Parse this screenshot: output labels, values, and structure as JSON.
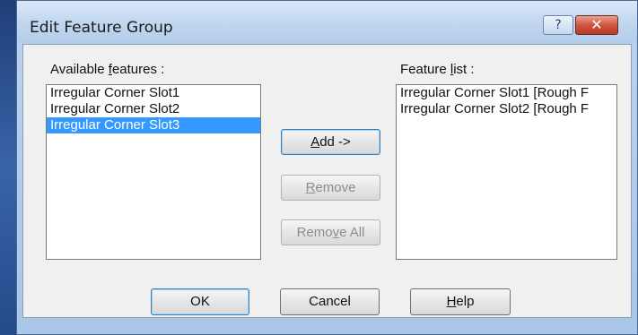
{
  "window": {
    "title": "Edit Feature Group",
    "help_glyph": "?",
    "close_glyph": "✕"
  },
  "available": {
    "label_pre": "Available ",
    "label_accel": "f",
    "label_post": "eatures :",
    "items": [
      "Irregular Corner Slot1",
      "Irregular Corner Slot2",
      "Irregular Corner Slot3"
    ],
    "selected_index": 2
  },
  "feature_list": {
    "label_pre": "Feature ",
    "label_accel": "l",
    "label_post": "ist :",
    "items": [
      "Irregular Corner Slot1 [Rough F",
      "Irregular Corner Slot2 [Rough F"
    ]
  },
  "buttons": {
    "add": {
      "pre": "",
      "accel": "A",
      "post": "dd ->"
    },
    "remove": {
      "pre": "",
      "accel": "R",
      "post": "emove"
    },
    "remove_all": {
      "pre": "Remo",
      "accel": "v",
      "post": "e All"
    },
    "ok": "OK",
    "cancel": "Cancel",
    "help": {
      "pre": "",
      "accel": "H",
      "post": "elp"
    }
  }
}
